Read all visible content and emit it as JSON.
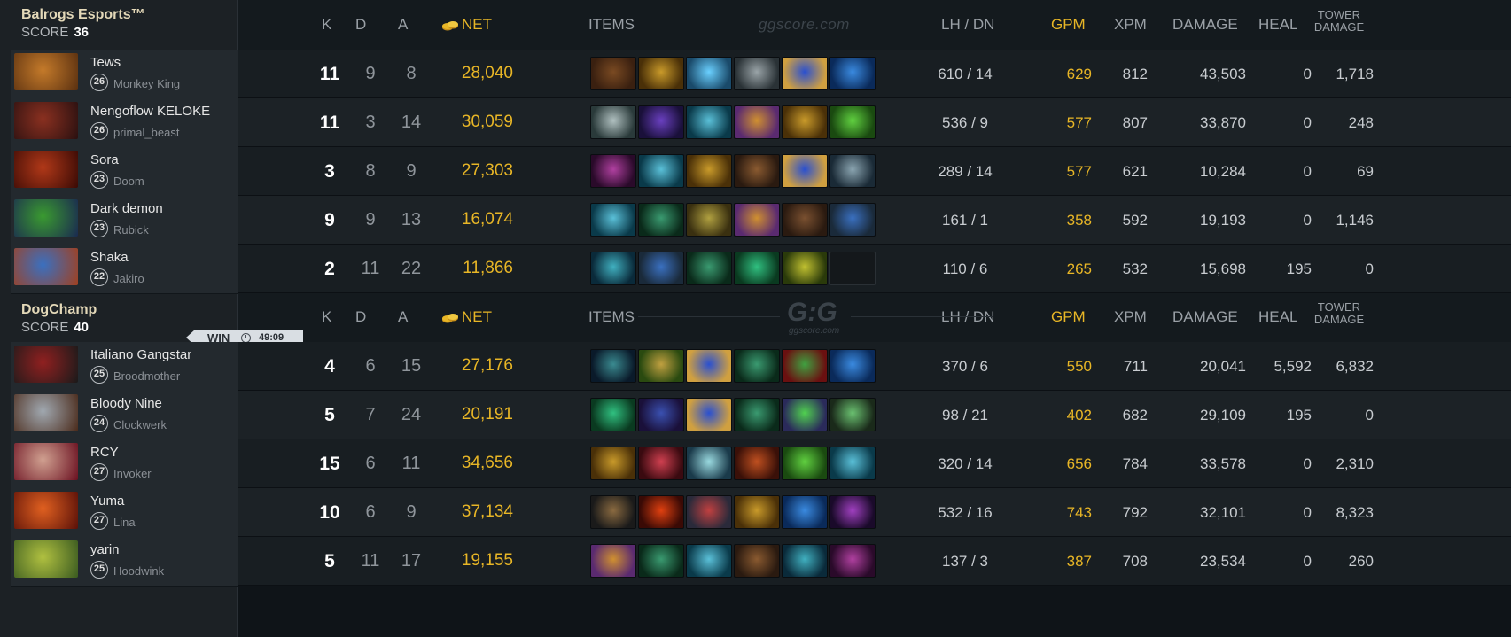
{
  "watermark": {
    "top": "ggscore.com",
    "logo": "G:G",
    "logo_sub": "ggscore.com"
  },
  "headers": {
    "k": "K",
    "d": "D",
    "a": "A",
    "net": "NET",
    "items": "ITEMS",
    "lh_dn": "LH  /  DN",
    "gpm": "GPM",
    "xpm": "XPM",
    "damage": "DAMAGE",
    "heal": "HEAL",
    "tower_line1": "TOWER",
    "tower_line2": "DAMAGE"
  },
  "teams": [
    {
      "name": "Balrogs  Esports™",
      "score_label": "SCORE",
      "score": "36",
      "players": [
        {
          "name": "Tews",
          "level": "26",
          "hero": "Monkey King",
          "k": "11",
          "d": "9",
          "a": "8",
          "net": "28,040",
          "lh_dn": "610  /  14",
          "gpm": "629",
          "xpm": "812",
          "damage": "43,503",
          "heal": "0",
          "tower": "1,718",
          "portrait": [
            "#c47a2a",
            "#5a3010"
          ],
          "items": [
            [
              "#7a4a22",
              "#3a2010"
            ],
            [
              "#c99a2a",
              "#4a3008"
            ],
            [
              "#6ad0ff",
              "#1a4a6a"
            ],
            [
              "#9aa4a8",
              "#2a3236"
            ],
            [
              "#2a50d0",
              "#d0a040"
            ],
            [
              "#3a8ae0",
              "#0a2a5a"
            ]
          ]
        },
        {
          "name": "Nengoflow KELOKE",
          "level": "26",
          "hero": "primal_beast",
          "k": "11",
          "d": "3",
          "a": "14",
          "net": "30,059",
          "lh_dn": "536  /  9",
          "gpm": "577",
          "xpm": "807",
          "damage": "33,870",
          "heal": "0",
          "tower": "248",
          "portrait": [
            "#8a3020",
            "#2a1010"
          ],
          "items": [
            [
              "#b0c0c0",
              "#2a3a3a"
            ],
            [
              "#6a40c0",
              "#1a103a"
            ],
            [
              "#5ac0d8",
              "#0a3a4a"
            ],
            [
              "#d09030",
              "#5a2a70"
            ],
            [
              "#c99a2a",
              "#4a3008"
            ],
            [
              "#60d040",
              "#1a4a10"
            ]
          ]
        },
        {
          "name": "Sora",
          "level": "23",
          "hero": "Doom",
          "k": "3",
          "d": "8",
          "a": "9",
          "net": "27,303",
          "lh_dn": "289  /  14",
          "gpm": "577",
          "xpm": "621",
          "damage": "10,284",
          "heal": "0",
          "tower": "69",
          "portrait": [
            "#b03818",
            "#3a0a05"
          ],
          "items": [
            [
              "#b040a0",
              "#2a0a2a"
            ],
            [
              "#5ac0d8",
              "#0a3a4a"
            ],
            [
              "#c99a2a",
              "#4a3008"
            ],
            [
              "#8a5a30",
              "#2a1a10"
            ],
            [
              "#2a50d0",
              "#d0a040"
            ],
            [
              "#8aa4b0",
              "#1a2a36"
            ]
          ]
        },
        {
          "name": "Dark demon",
          "level": "23",
          "hero": "Rubick",
          "k": "9",
          "d": "9",
          "a": "13",
          "net": "16,074",
          "lh_dn": "161  /  1",
          "gpm": "358",
          "xpm": "592",
          "damage": "19,193",
          "heal": "0",
          "tower": "1,146",
          "portrait": [
            "#3a9a30",
            "#1a2a50"
          ],
          "items": [
            [
              "#5ac0d8",
              "#0a3a4a"
            ],
            [
              "#3a9a70",
              "#0a2a1a"
            ],
            [
              "#b0a040",
              "#3a3010"
            ],
            [
              "#d09030",
              "#5a2a70"
            ],
            [
              "#7a5030",
              "#2a1a10"
            ],
            [
              "#3a70c0",
              "#1a2a3a"
            ]
          ]
        },
        {
          "name": "Shaka",
          "level": "22",
          "hero": "Jakiro",
          "k": "2",
          "d": "11",
          "a": "22",
          "net": "11,866",
          "lh_dn": "110  /  6",
          "gpm": "265",
          "xpm": "532",
          "damage": "15,698",
          "heal": "195",
          "tower": "0",
          "portrait": [
            "#3a70c0",
            "#a04020"
          ],
          "items": [
            [
              "#40b0c0",
              "#0a2a3a"
            ],
            [
              "#3a70c0",
              "#1a2a3a"
            ],
            [
              "#3a9a70",
              "#0a2a1a"
            ],
            [
              "#30c080",
              "#0a3a20"
            ],
            [
              "#c0c030",
              "#2a3a0a"
            ],
            null
          ]
        }
      ]
    },
    {
      "name": "DogChamp",
      "score_label": "SCORE",
      "score": "40",
      "result": "WIN",
      "duration": "49:09",
      "players": [
        {
          "name": "Italiano Gangstar",
          "level": "25",
          "hero": "Broodmother",
          "k": "4",
          "d": "6",
          "a": "15",
          "net": "27,176",
          "lh_dn": "370  /  6",
          "gpm": "550",
          "xpm": "711",
          "damage": "20,041",
          "heal": "5,592",
          "tower": "6,832",
          "portrait": [
            "#902020",
            "#1a1a1a"
          ],
          "items": [
            [
              "#3a8a90",
              "#0a1a2a"
            ],
            [
              "#c0a040",
              "#2a4a10"
            ],
            [
              "#2a50d0",
              "#d0a040"
            ],
            [
              "#3a9a70",
              "#0a2a1a"
            ],
            [
              "#40a040",
              "#6a1010"
            ],
            [
              "#3a8ae0",
              "#0a2a5a"
            ]
          ]
        },
        {
          "name": "Bloody Nine",
          "level": "24",
          "hero": "Clockwerk",
          "k": "5",
          "d": "7",
          "a": "24",
          "net": "20,191",
          "lh_dn": "98  /  21",
          "gpm": "402",
          "xpm": "682",
          "damage": "29,109",
          "heal": "195",
          "tower": "0",
          "portrait": [
            "#a0a8b0",
            "#4a2a1a"
          ],
          "items": [
            [
              "#30c080",
              "#0a3a20"
            ],
            [
              "#3a50b0",
              "#1a103a"
            ],
            [
              "#2a50d0",
              "#d0a040"
            ],
            [
              "#3a9a70",
              "#0a2a1a"
            ],
            [
              "#50d050",
              "#2a2a5a"
            ],
            [
              "#6ac070",
              "#1a2a1a"
            ]
          ]
        },
        {
          "name": "RCY",
          "level": "27",
          "hero": "Invoker",
          "k": "15",
          "d": "6",
          "a": "11",
          "net": "34,656",
          "lh_dn": "320  /  14",
          "gpm": "656",
          "xpm": "784",
          "damage": "33,578",
          "heal": "0",
          "tower": "2,310",
          "portrait": [
            "#d0a090",
            "#6a1020"
          ],
          "items": [
            [
              "#c99a2a",
              "#4a3008"
            ],
            [
              "#d04050",
              "#3a0a10"
            ],
            [
              "#9adae0",
              "#1a3a4a"
            ],
            [
              "#c05020",
              "#3a1008"
            ],
            [
              "#60d040",
              "#1a4a10"
            ],
            [
              "#5ac0d8",
              "#0a3a4a"
            ]
          ]
        },
        {
          "name": "Yuma",
          "level": "27",
          "hero": "Lina",
          "k": "10",
          "d": "6",
          "a": "9",
          "net": "37,134",
          "lh_dn": "532  /  16",
          "gpm": "743",
          "xpm": "792",
          "damage": "32,101",
          "heal": "0",
          "tower": "8,323",
          "portrait": [
            "#e06020",
            "#5a1008"
          ],
          "items": [
            [
              "#8a6a40",
              "#1a1a1a"
            ],
            [
              "#e04010",
              "#3a0a05"
            ],
            [
              "#c04040",
              "#2a2a3a"
            ],
            [
              "#c99a2a",
              "#4a3008"
            ],
            [
              "#3a8ae0",
              "#0a2a5a"
            ],
            [
              "#a040c0",
              "#1a0a2a"
            ]
          ]
        },
        {
          "name": "yarin",
          "level": "25",
          "hero": "Hoodwink",
          "k": "5",
          "d": "11",
          "a": "17",
          "net": "19,155",
          "lh_dn": "137  /  3",
          "gpm": "387",
          "xpm": "708",
          "damage": "23,534",
          "heal": "0",
          "tower": "260",
          "portrait": [
            "#b0c040",
            "#3a5a20"
          ],
          "items": [
            [
              "#d09030",
              "#5a2a70"
            ],
            [
              "#3a9a70",
              "#0a2a1a"
            ],
            [
              "#5ac0d8",
              "#0a3a4a"
            ],
            [
              "#8a5a30",
              "#2a1a10"
            ],
            [
              "#40b0c0",
              "#0a2a3a"
            ],
            [
              "#b040a0",
              "#2a0a2a"
            ]
          ]
        }
      ]
    }
  ]
}
